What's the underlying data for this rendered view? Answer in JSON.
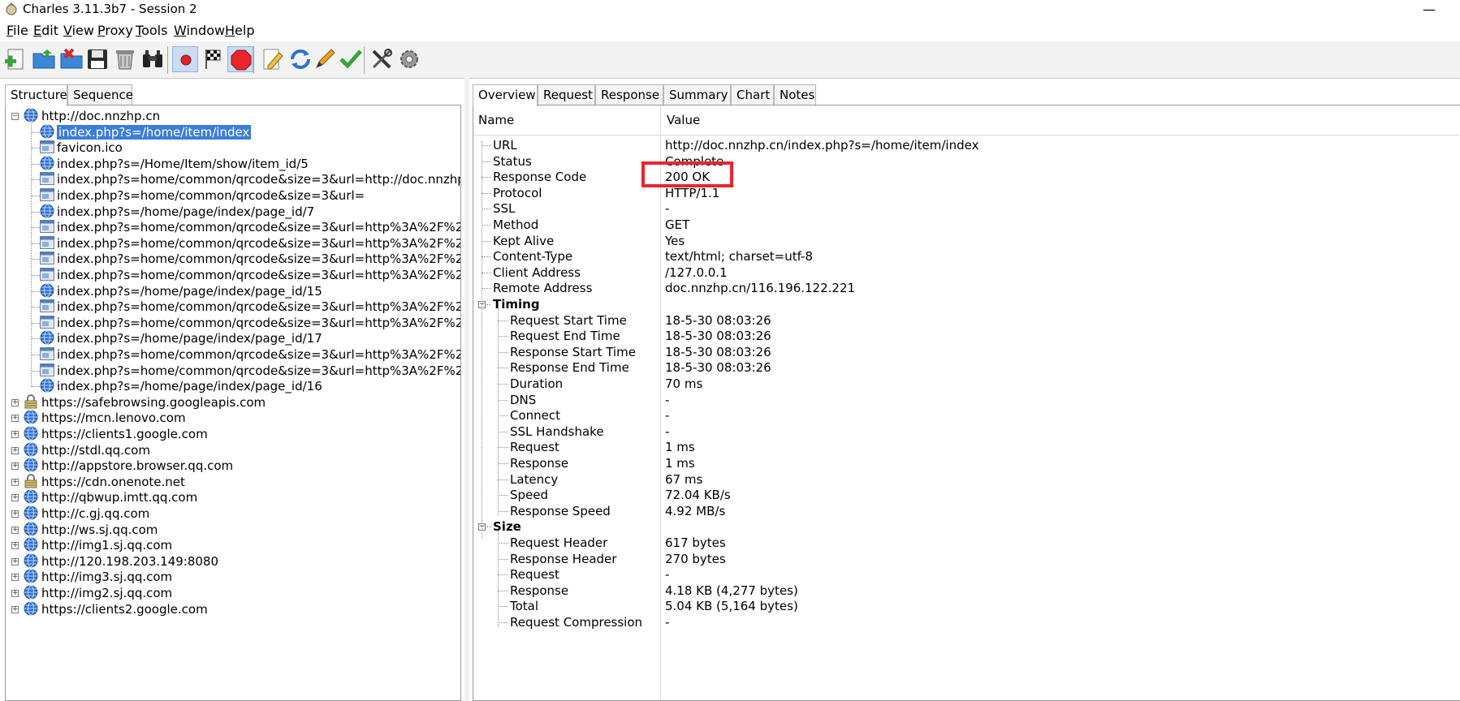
{
  "window": {
    "title": "Charles 3.11.3b7 - Session 2",
    "minimize_glyph": "—"
  },
  "menu": [
    {
      "label": "File",
      "mnemonic": "F",
      "rest": "ile"
    },
    {
      "label": "Edit",
      "mnemonic": "E",
      "rest": "dit"
    },
    {
      "label": "View",
      "mnemonic": "V",
      "rest": "iew"
    },
    {
      "label": "Proxy",
      "mnemonic": "P",
      "rest": "roxy"
    },
    {
      "label": "Tools",
      "mnemonic": "T",
      "rest": "ools"
    },
    {
      "label": "Window",
      "mnemonic": "W",
      "rest": "indow"
    },
    {
      "label": "Help",
      "mnemonic": "H",
      "rest": "elp"
    }
  ],
  "toolbar": {
    "buttons": [
      "new-session-icon",
      "open-session-icon",
      "close-session-icon",
      "save-session-icon",
      "clear-session-icon",
      "find-icon",
      "record-icon",
      "throttle-icon",
      "breakpoints-icon",
      "compose-icon",
      "repeat-icon",
      "edit-icon",
      "validate-icon",
      "tools-icon",
      "settings-icon"
    ],
    "pressed": [
      "record-icon",
      "breakpoints-icon"
    ]
  },
  "left": {
    "tabs": [
      "Structure",
      "Sequence"
    ],
    "active_tab": "Structure",
    "root": "http://doc.nnzhp.cn",
    "children": [
      {
        "label": "index.php?s=/home/item/index",
        "icon": "globe",
        "selected": true
      },
      {
        "label": "favicon.ico",
        "icon": "doc"
      },
      {
        "label": "index.php?s=/Home/Item/show/item_id/5",
        "icon": "globe"
      },
      {
        "label": "index.php?s=home/common/qrcode&size=3&url=http://doc.nnzhp",
        "icon": "doc"
      },
      {
        "label": "index.php?s=home/common/qrcode&size=3&url=",
        "icon": "doc"
      },
      {
        "label": "index.php?s=/home/page/index/page_id/7",
        "icon": "globe"
      },
      {
        "label": "index.php?s=home/common/qrcode&size=3&url=http%3A%2F%2",
        "icon": "doc"
      },
      {
        "label": "index.php?s=home/common/qrcode&size=3&url=http%3A%2F%2",
        "icon": "doc"
      },
      {
        "label": "index.php?s=home/common/qrcode&size=3&url=http%3A%2F%2",
        "icon": "doc"
      },
      {
        "label": "index.php?s=home/common/qrcode&size=3&url=http%3A%2F%2",
        "icon": "doc"
      },
      {
        "label": "index.php?s=/home/page/index/page_id/15",
        "icon": "globe"
      },
      {
        "label": "index.php?s=home/common/qrcode&size=3&url=http%3A%2F%2",
        "icon": "doc"
      },
      {
        "label": "index.php?s=home/common/qrcode&size=3&url=http%3A%2F%2",
        "icon": "doc"
      },
      {
        "label": "index.php?s=/home/page/index/page_id/17",
        "icon": "globe"
      },
      {
        "label": "index.php?s=home/common/qrcode&size=3&url=http%3A%2F%2",
        "icon": "doc"
      },
      {
        "label": "index.php?s=home/common/qrcode&size=3&url=http%3A%2F%2",
        "icon": "doc"
      },
      {
        "label": "index.php?s=/home/page/index/page_id/16",
        "icon": "globe"
      }
    ],
    "hosts": [
      {
        "label": "https://safebrowsing.googleapis.com",
        "icon": "lock"
      },
      {
        "label": "https://mcn.lenovo.com",
        "icon": "globe"
      },
      {
        "label": "https://clients1.google.com",
        "icon": "globe"
      },
      {
        "label": "http://stdl.qq.com",
        "icon": "globe"
      },
      {
        "label": "http://appstore.browser.qq.com",
        "icon": "globe"
      },
      {
        "label": "https://cdn.onenote.net",
        "icon": "lock"
      },
      {
        "label": "http://qbwup.imtt.qq.com",
        "icon": "globe"
      },
      {
        "label": "http://c.gj.qq.com",
        "icon": "globe"
      },
      {
        "label": "http://ws.sj.qq.com",
        "icon": "globe"
      },
      {
        "label": "http://img1.sj.qq.com",
        "icon": "globe"
      },
      {
        "label": "http://120.198.203.149:8080",
        "icon": "globe"
      },
      {
        "label": "http://img3.sj.qq.com",
        "icon": "globe"
      },
      {
        "label": "http://img2.sj.qq.com",
        "icon": "globe"
      },
      {
        "label": "https://clients2.google.com",
        "icon": "globe"
      }
    ]
  },
  "right": {
    "tabs": [
      "Overview",
      "Request",
      "Response",
      "Summary",
      "Chart",
      "Notes"
    ],
    "active_tab": "Overview",
    "columns": [
      "Name",
      "Value"
    ],
    "rows": [
      {
        "name": "URL",
        "value": "http://doc.nnzhp.cn/index.php?s=/home/item/index",
        "level": 1
      },
      {
        "name": "Status",
        "value": "Complete",
        "level": 1
      },
      {
        "name": "Response Code",
        "value": "200 OK",
        "level": 1,
        "highlight": true
      },
      {
        "name": "Protocol",
        "value": "HTTP/1.1",
        "level": 1
      },
      {
        "name": "SSL",
        "value": "-",
        "level": 1
      },
      {
        "name": "Method",
        "value": "GET",
        "level": 1
      },
      {
        "name": "Kept Alive",
        "value": "Yes",
        "level": 1
      },
      {
        "name": "Content-Type",
        "value": "text/html; charset=utf-8",
        "level": 1
      },
      {
        "name": "Client Address",
        "value": "/127.0.0.1",
        "level": 1
      },
      {
        "name": "Remote Address",
        "value": "doc.nnzhp.cn/116.196.122.221",
        "level": 1
      },
      {
        "name": "Timing",
        "value": "",
        "level": 0,
        "group": true
      },
      {
        "name": "Request Start Time",
        "value": "18-5-30 08:03:26",
        "level": 2
      },
      {
        "name": "Request End Time",
        "value": "18-5-30 08:03:26",
        "level": 2
      },
      {
        "name": "Response Start Time",
        "value": "18-5-30 08:03:26",
        "level": 2
      },
      {
        "name": "Response End Time",
        "value": "18-5-30 08:03:26",
        "level": 2
      },
      {
        "name": "Duration",
        "value": "70 ms",
        "level": 2
      },
      {
        "name": "DNS",
        "value": "-",
        "level": 2
      },
      {
        "name": "Connect",
        "value": "-",
        "level": 2
      },
      {
        "name": "SSL Handshake",
        "value": "-",
        "level": 2
      },
      {
        "name": "Request",
        "value": "1 ms",
        "level": 2
      },
      {
        "name": "Response",
        "value": "1 ms",
        "level": 2
      },
      {
        "name": "Latency",
        "value": "67 ms",
        "level": 2
      },
      {
        "name": "Speed",
        "value": "72.04 KB/s",
        "level": 2
      },
      {
        "name": "Response Speed",
        "value": "4.92 MB/s",
        "level": 2
      },
      {
        "name": "Size",
        "value": "",
        "level": 0,
        "group": true
      },
      {
        "name": "Request Header",
        "value": "617 bytes",
        "level": 2
      },
      {
        "name": "Response Header",
        "value": "270 bytes",
        "level": 2
      },
      {
        "name": "Request",
        "value": "-",
        "level": 2
      },
      {
        "name": "Response",
        "value": "4.18 KB (4,277 bytes)",
        "level": 2
      },
      {
        "name": "Total",
        "value": "5.04 KB (5,164 bytes)",
        "level": 2
      },
      {
        "name": "Request Compression",
        "value": "-",
        "level": 2
      }
    ]
  },
  "colors": {
    "selection": "#3d7cd8",
    "highlight_box": "#e8262b",
    "globe": "#2f6fd0"
  }
}
